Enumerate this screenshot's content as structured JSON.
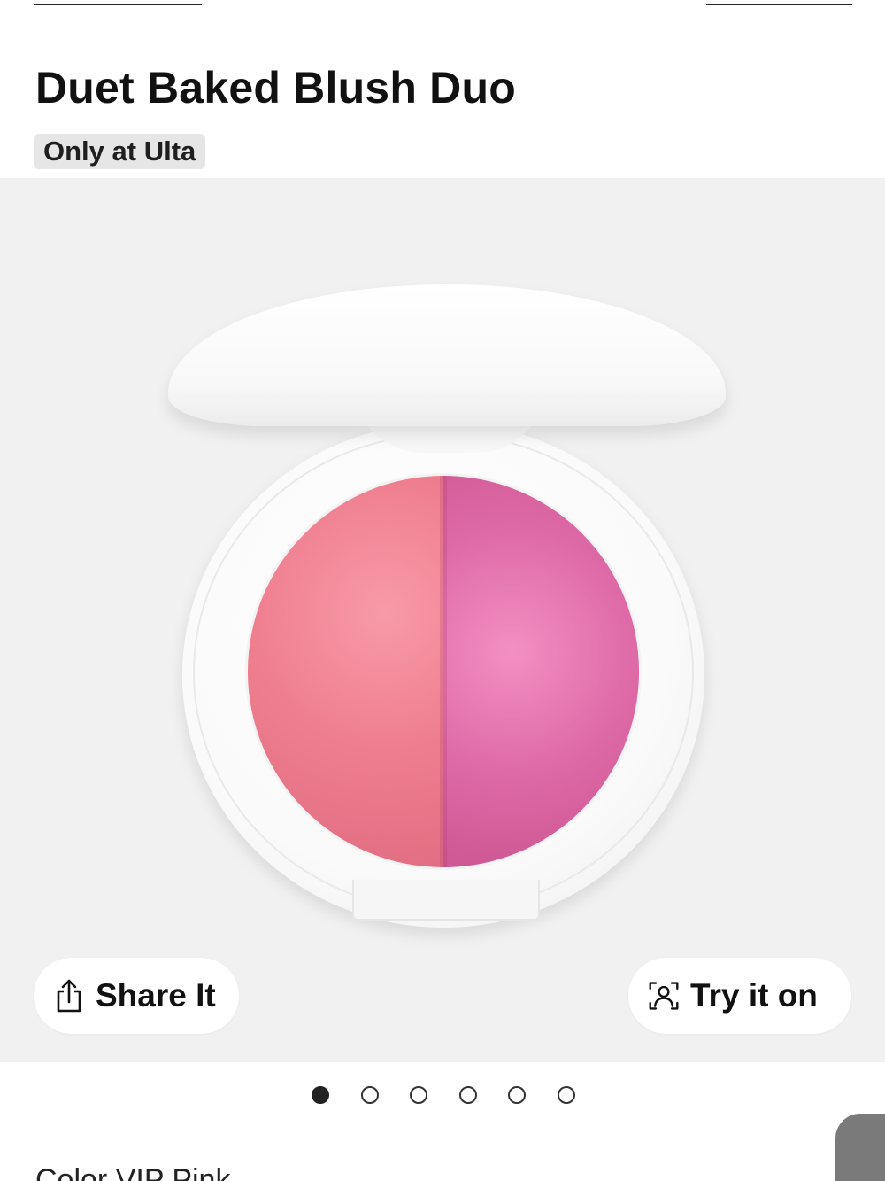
{
  "product": {
    "title": "Duet Baked Blush Duo",
    "exclusive_badge": "Only at Ulta",
    "color_label": "Color VIP Pink"
  },
  "actions": {
    "share": {
      "label": "Share It",
      "icon": "share-icon"
    },
    "try_on": {
      "label": "Try it on",
      "icon": "face-scan-icon"
    }
  },
  "gallery": {
    "image_count": 6,
    "active_index": 0,
    "colors": {
      "blush_left": "#ef7f90",
      "blush_right": "#dd69a6",
      "background": "#f1f1f1"
    }
  }
}
